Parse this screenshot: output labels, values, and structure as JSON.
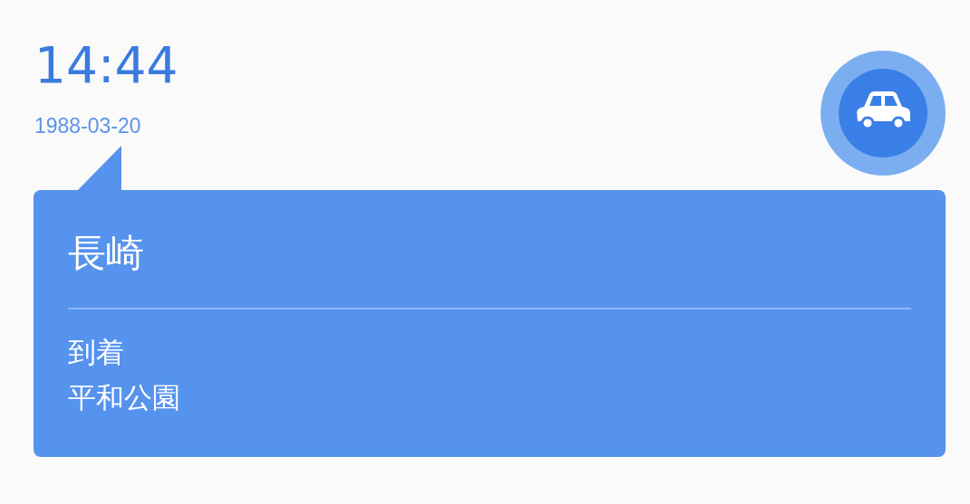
{
  "time": "14:44",
  "date": "1988-03-20",
  "card": {
    "title": "長崎",
    "lines": [
      "到着",
      "平和公園"
    ]
  }
}
